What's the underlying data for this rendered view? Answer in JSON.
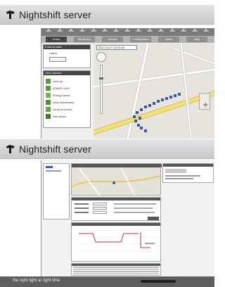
{
  "header1": {
    "title": "Nightshift server"
  },
  "header2": {
    "title": "Nightshift server"
  },
  "shot1": {
    "tabs": [
      "Home",
      "Monitoring",
      "Events",
      "Configuration",
      "Users",
      "Help"
    ],
    "active_tab": "Home",
    "external_data": {
      "title": "External data",
      "item": "Latest"
    },
    "clock": "2012-04-07 15:46:59",
    "view_chooser": {
      "title": "View chooser",
      "items": [
        "View all",
        "ZONES 1/4/5",
        "Energy saved",
        "Area deactivated",
        "Lamp inventory",
        "Dim failure"
      ]
    }
  },
  "tagline": "the right light at right time",
  "colors": {
    "header": "#d6d6d6",
    "map_bg": "#e6e4dd",
    "road_major": "#f2e17a",
    "marker": "#3a57a8",
    "tag_bar": "#282828"
  }
}
